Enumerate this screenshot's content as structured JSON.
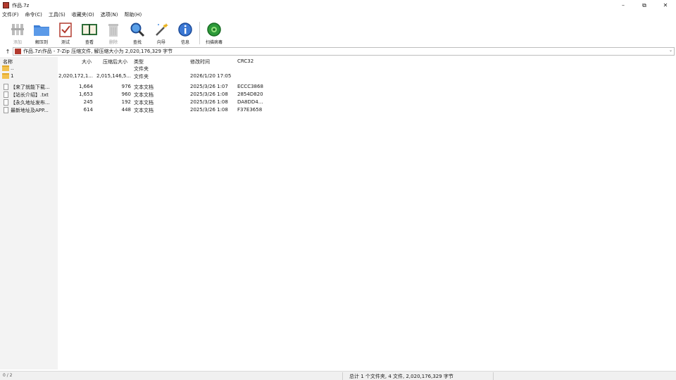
{
  "window": {
    "title": "作品.7z",
    "controls": [
      "–",
      "⧉",
      "✕"
    ]
  },
  "menu": [
    "文件(F)",
    "命令(C)",
    "工具(S)",
    "收藏夹(O)",
    "选项(N)",
    "帮助(H)"
  ],
  "toolbar": [
    {
      "label": "添加",
      "icon": "add-archive-icon",
      "disabled": true
    },
    {
      "label": "解压到",
      "icon": "extract-to-icon",
      "disabled": false
    },
    {
      "label": "测试",
      "icon": "test-icon",
      "disabled": false
    },
    {
      "label": "查看",
      "icon": "view-book-icon",
      "disabled": false
    },
    {
      "label": "删除",
      "icon": "delete-trash-icon",
      "disabled": true
    },
    {
      "label": "查找",
      "icon": "find-magnifier-icon",
      "disabled": false
    },
    {
      "label": "向导",
      "icon": "wizard-wand-icon",
      "disabled": false
    },
    {
      "label": "信息",
      "icon": "info-icon",
      "disabled": false
    },
    {
      "label": "扫描病毒",
      "icon": "virus-scan-icon",
      "disabled": false
    }
  ],
  "address": {
    "up": "↑",
    "path": "作品.7z\\作品 - 7-Zip 压缩文件, 解压缩大小为 2,020,176,329 字节"
  },
  "columns": {
    "name": "名称",
    "size": "大小",
    "packed": "压缩后大小",
    "type": "类型",
    "modified": "修改时间",
    "crc": "CRC32"
  },
  "rows": [
    {
      "kind": "folder",
      "name": "..",
      "size": "",
      "packed": "",
      "type": "文件夹",
      "modified": "",
      "crc": ""
    },
    {
      "kind": "folder",
      "name": "1",
      "size": "2,020,172,1...",
      "packed": "2,015,146,5...",
      "type": "文件夹",
      "modified": "2026/1/20 17:05",
      "crc": ""
    },
    {
      "kind": "file",
      "name": "【来了就能下载...",
      "size": "1,664",
      "packed": "976",
      "type": "文本文档",
      "modified": "2025/3/26 1:07",
      "crc": "ECCC3868"
    },
    {
      "kind": "file",
      "name": "【站长介绍】.txt",
      "size": "1,653",
      "packed": "960",
      "type": "文本文档",
      "modified": "2025/3/26 1:08",
      "crc": "2854D820"
    },
    {
      "kind": "file",
      "name": "【永久地址发布...",
      "size": "245",
      "packed": "192",
      "type": "文本文档",
      "modified": "2025/3/26 1:08",
      "crc": "DA8DD4..."
    },
    {
      "kind": "file",
      "name": "最新地址及APP...",
      "size": "614",
      "packed": "448",
      "type": "文本文档",
      "modified": "2025/3/26 1:08",
      "crc": "F37E3658"
    }
  ],
  "status": {
    "left": "0 / 2",
    "summary": "总计 1 个文件夹, 4 文件, 2,020,176,329 字节"
  }
}
